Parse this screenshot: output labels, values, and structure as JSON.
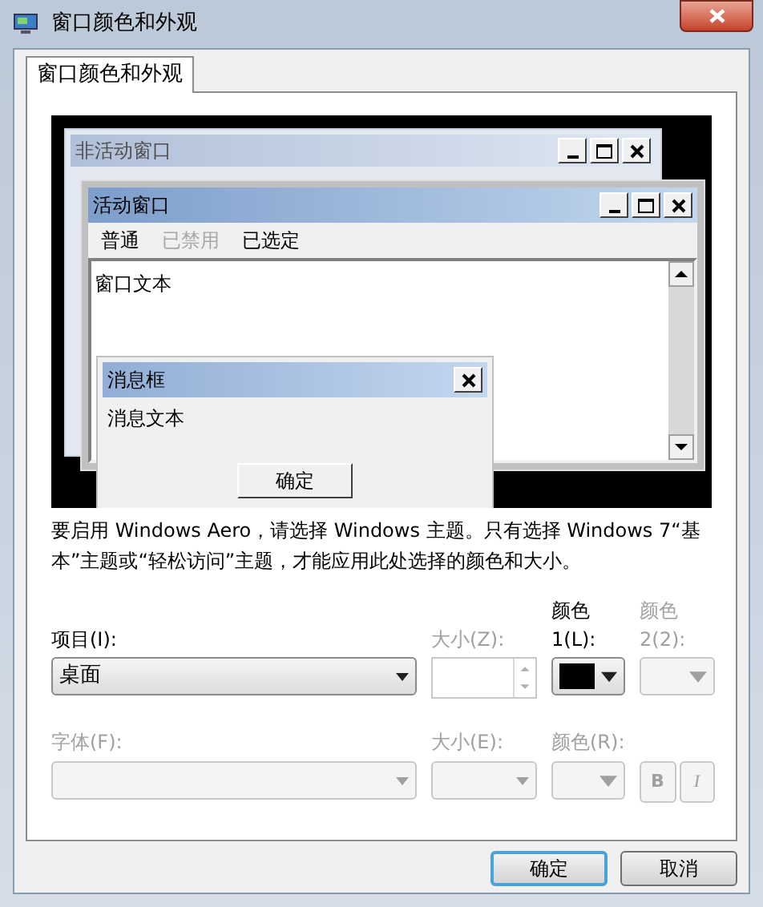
{
  "window": {
    "title": "窗口颜色和外观"
  },
  "tabs": [
    {
      "label": "窗口颜色和外观",
      "selected": true
    }
  ],
  "preview": {
    "inactive_window": {
      "title": "非活动窗口"
    },
    "active_window": {
      "title": "活动窗口",
      "text": "窗口文本",
      "menu": [
        {
          "label": "普通",
          "disabled": false
        },
        {
          "label": "已禁用",
          "disabled": true
        },
        {
          "label": "已选定",
          "disabled": false
        }
      ]
    },
    "message_box": {
      "title": "消息框",
      "text": "消息文本",
      "button": "确定"
    }
  },
  "note": "要启用 Windows Aero，请选择 Windows 主题。只有选择 Windows 7“基本”主题或“轻松访问”主题，才能应用此处选择的颜色和大小。",
  "fields": [
    {
      "kind": "combo",
      "label": "项目(I):",
      "value": "桌面",
      "disabled": false
    },
    {
      "kind": "spin",
      "label": "大小(Z):",
      "disabled": true
    },
    {
      "kind": "color",
      "label": "颜色 1(L):",
      "disabled": false,
      "color": "#000000"
    },
    {
      "kind": "color",
      "label": "颜色 2(2):",
      "disabled": true
    }
  ],
  "font_fields": [
    {
      "kind": "combo",
      "label": "字体(F):",
      "disabled": true
    },
    {
      "kind": "combo",
      "label": "大小(E):",
      "disabled": true
    },
    {
      "kind": "color",
      "label": "颜色(R):",
      "disabled": true
    }
  ],
  "style_buttons": [
    {
      "label": "B",
      "italic": false,
      "disabled": true
    },
    {
      "label": "I",
      "italic": true,
      "disabled": true
    }
  ],
  "buttons": [
    {
      "label": "确定",
      "default": true
    },
    {
      "label": "取消",
      "default": false
    }
  ]
}
